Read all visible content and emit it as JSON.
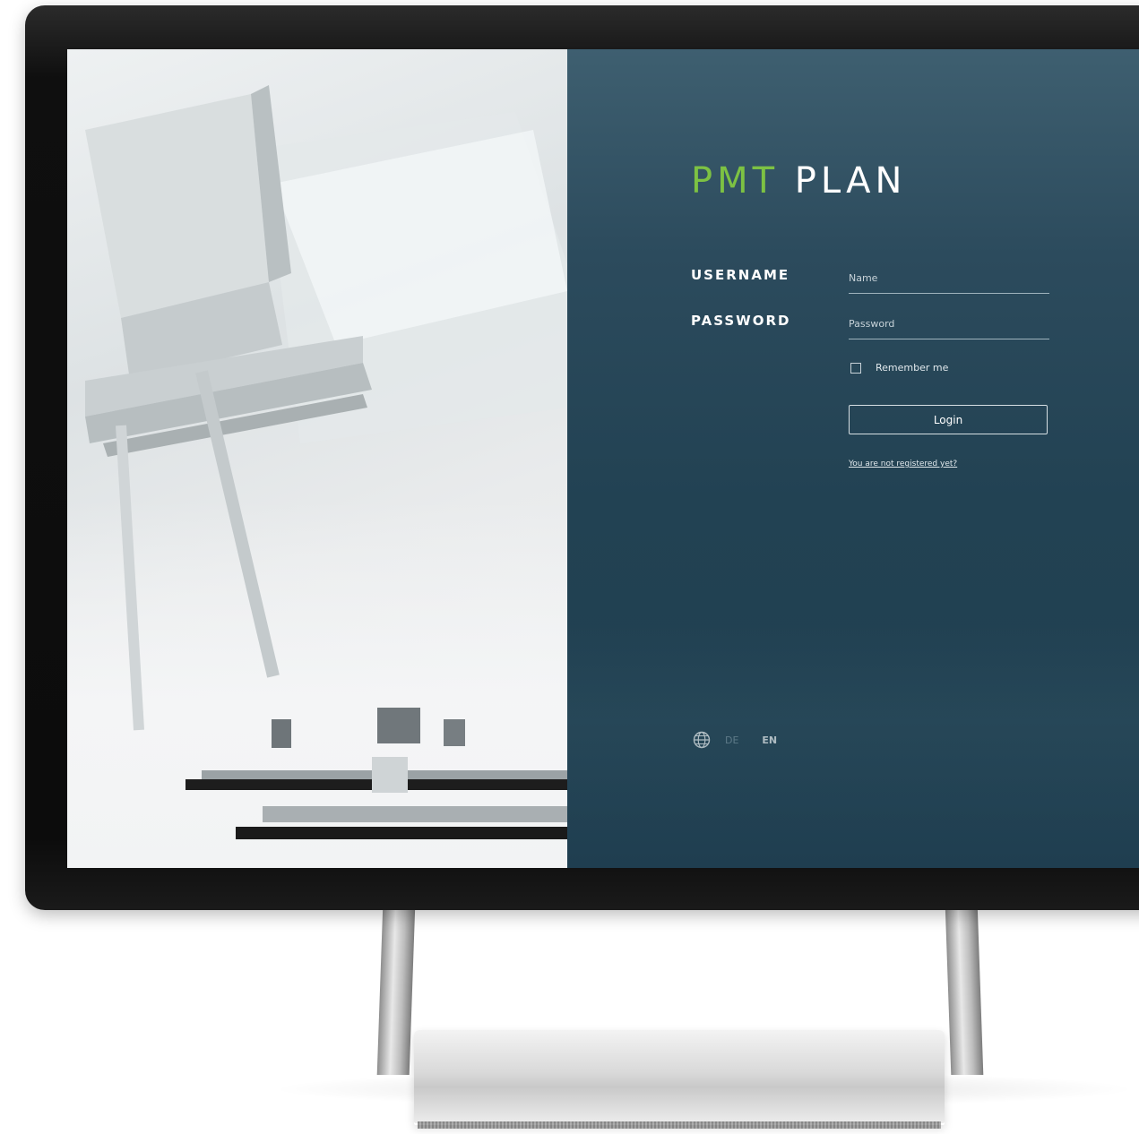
{
  "brand": {
    "accent_text": "PMT",
    "main_text": "PLAN",
    "accent_color": "#7dc243",
    "main_color": "#ffffff"
  },
  "login_form": {
    "username_label": "USERNAME",
    "username_placeholder": "Name",
    "password_label": "PASSWORD",
    "password_placeholder": "Password",
    "remember_label": "Remember me",
    "remember_checked": false,
    "login_button_label": "Login",
    "register_link": "You are not registered yet?"
  },
  "language_switcher": {
    "icon": "globe-icon",
    "options": [
      "DE",
      "EN"
    ],
    "active": "EN"
  },
  "colors": {
    "panel_background": "#224253",
    "hero_background": "#e6e9ea"
  }
}
